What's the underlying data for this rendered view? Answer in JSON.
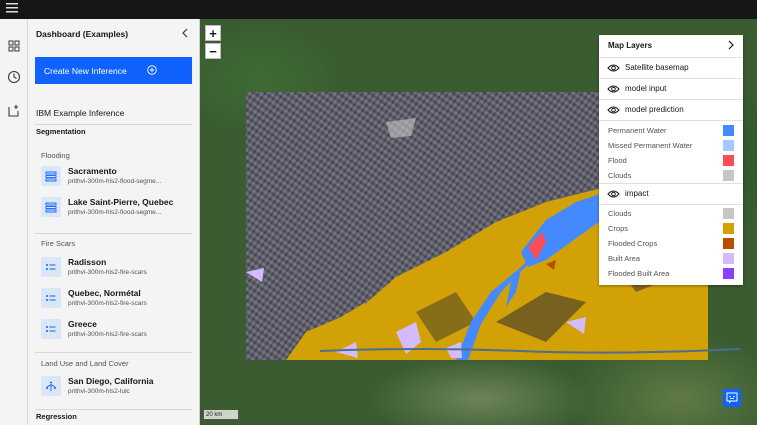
{
  "sidebar": {
    "title": "Dashboard (Examples)",
    "create_button": "Create New Inference",
    "inference_label": "IBM Example Inference",
    "sections": {
      "segmentation": "Segmentation",
      "regression": "Regression"
    },
    "groups": {
      "flooding": "Flooding",
      "fire_scars": "Fire Scars",
      "land_use": "Land Use and Land Cover"
    },
    "items": [
      {
        "name": "Sacramento",
        "model": "prithvi-300m-hls2-flood-segme..."
      },
      {
        "name": "Lake Saint-Pierre, Quebec",
        "model": "prithvi-300m-hls2-flood-segme..."
      },
      {
        "name": "Radisson",
        "model": "prithvi-300m-hls2-fire-scars"
      },
      {
        "name": "Quebec, Normétal",
        "model": "prithvi-300m-hls2-fire-scars"
      },
      {
        "name": "Greece",
        "model": "prithvi-300m-hls2-fire-scars"
      },
      {
        "name": "San Diego, California",
        "model": "prithvi-300m-hls2-lulc"
      }
    ]
  },
  "map": {
    "zoom_in": "+",
    "zoom_out": "−",
    "scale": "20 km"
  },
  "layers_panel": {
    "title": "Map Layers",
    "layers": [
      "Satellite basemap",
      "model input",
      "model prediction",
      "impact"
    ],
    "prediction_legend": [
      {
        "label": "Permanent Water",
        "color": "#4589ff"
      },
      {
        "label": "Missed Permanent Water",
        "color": "#a6c8ff"
      },
      {
        "label": "Flood",
        "color": "#fa4d56"
      },
      {
        "label": "Clouds",
        "color": "#c6c6c6"
      }
    ],
    "impact_legend": [
      {
        "label": "Clouds",
        "color": "#c6c6c6"
      },
      {
        "label": "Crops",
        "color": "#d2a106"
      },
      {
        "label": "Flooded Crops",
        "color": "#ba4e00"
      },
      {
        "label": "Built Area",
        "color": "#d4bbff"
      },
      {
        "label": "Flooded Built Area",
        "color": "#8a3ffc"
      }
    ]
  }
}
